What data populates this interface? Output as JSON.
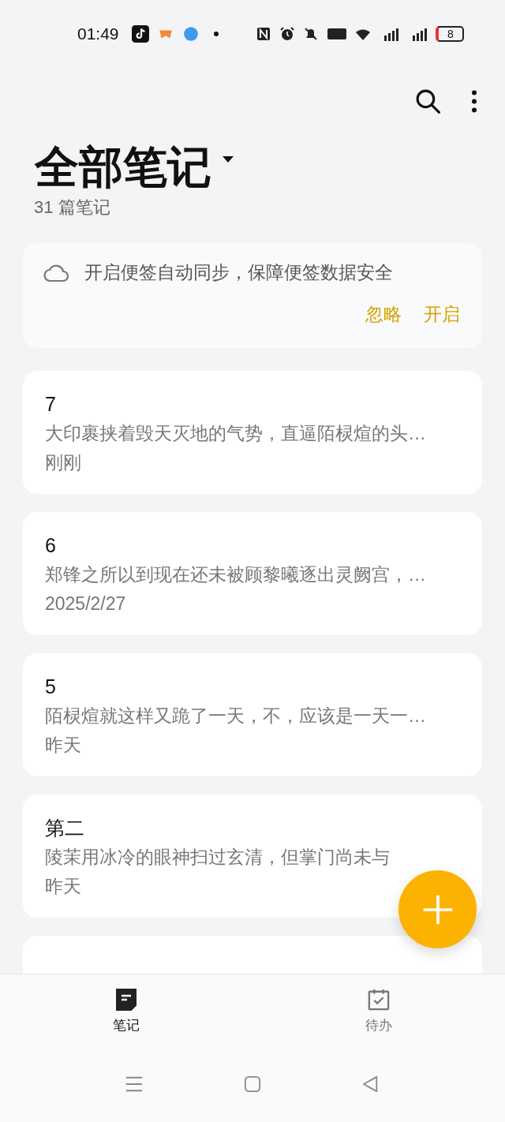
{
  "status_bar": {
    "time": "01:49",
    "battery": "8"
  },
  "header": {
    "title": "全部笔记",
    "subtitle": "31 篇笔记"
  },
  "sync_banner": {
    "message": "开启便签自动同步，保障便签数据安全",
    "buttons": [
      "忽略",
      "开启"
    ]
  },
  "notes": [
    {
      "title": "7",
      "preview": "大印裹挟着毁天灭地的气势，直逼陌棂煊的头…",
      "date": "刚刚"
    },
    {
      "title": "6",
      "preview": "郑锋之所以到现在还未被顾黎曦逐出灵阙宫，…",
      "date": "2025/2/27"
    },
    {
      "title": "5",
      "preview": "陌棂煊就这样又跪了一天，不，应该是一天一…",
      "date": "昨天"
    },
    {
      "title": "第二",
      "preview": "陵茉用冰冷的眼神扫过玄清，但掌门尚未与",
      "date": "昨天"
    }
  ],
  "more_notes_below": true,
  "bottom_nav": [
    {
      "label": "笔记",
      "kind": "notes",
      "selected": true
    },
    {
      "label": "待办",
      "kind": "todo",
      "selected": false
    }
  ]
}
